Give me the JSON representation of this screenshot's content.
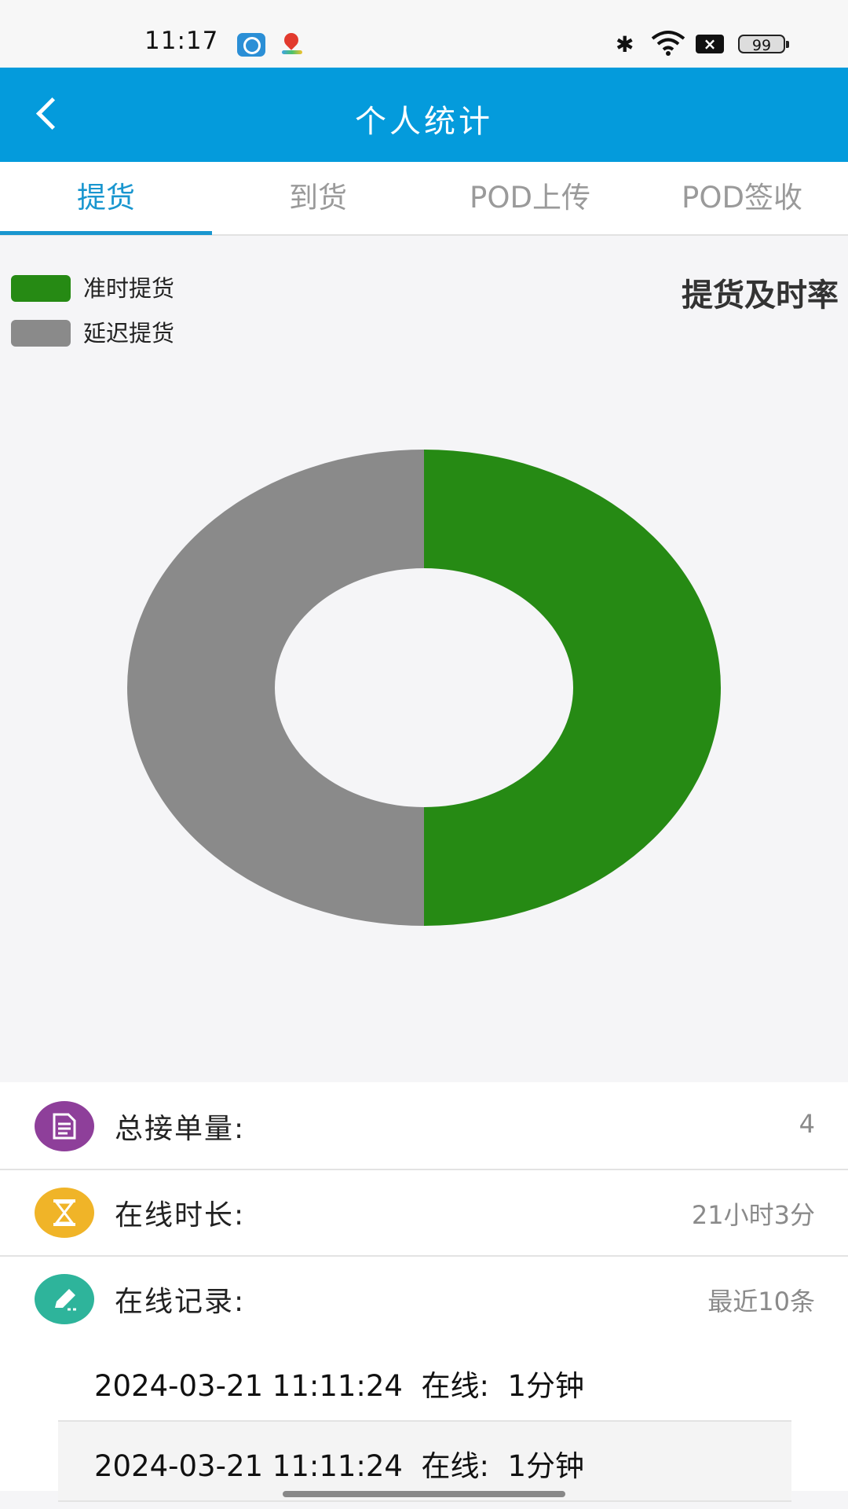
{
  "status_bar": {
    "time": "11:17",
    "battery": "99"
  },
  "app_bar": {
    "title": "个人统计"
  },
  "tabs": [
    {
      "label": "提货",
      "active": true
    },
    {
      "label": "到货",
      "active": false
    },
    {
      "label": "POD上传",
      "active": false
    },
    {
      "label": "POD签收",
      "active": false
    }
  ],
  "chart_data": {
    "type": "pie",
    "style": "donut",
    "title": "提货及时率",
    "legend_position": "top-left",
    "slices": [
      {
        "label": "准时提货",
        "value": 50,
        "color": "#268a14"
      },
      {
        "label": "延迟提货",
        "value": 50,
        "color": "#8a8a8a"
      }
    ]
  },
  "stats": {
    "total_orders": {
      "label": "总接单量:",
      "value": "4",
      "icon": "document-icon",
      "color": "#8e3f9a"
    },
    "online_duration": {
      "label": "在线时长:",
      "value": "21小时3分",
      "icon": "hourglass-icon",
      "color": "#f0b428"
    },
    "online_records": {
      "label": "在线记录:",
      "value": "最近10条",
      "icon": "pencil-icon",
      "color": "#2eb49b"
    }
  },
  "records": [
    {
      "time": "2024-03-21 11:11:24",
      "status": "在线:",
      "duration": "1分钟"
    },
    {
      "time": "2024-03-21 11:11:24",
      "status": "在线:",
      "duration": "1分钟"
    }
  ]
}
